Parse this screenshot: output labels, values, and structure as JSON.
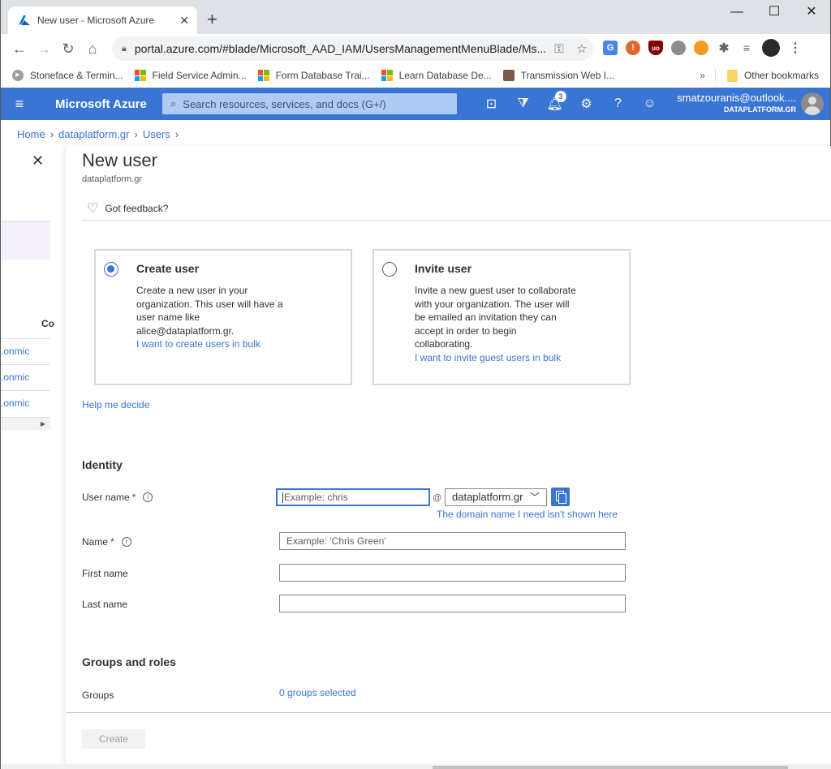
{
  "browser": {
    "tab_title": "New user - Microsoft Azure",
    "new_tab": "+",
    "window_controls": {
      "minimize": "—",
      "maximize": "☐",
      "close": "✕"
    },
    "url": "portal.azure.com/#blade/Microsoft_AAD_IAM/UsersManagementMenuBlade/Ms...",
    "bookmarks": [
      {
        "label": "Stoneface & Termin...",
        "icon": "play-icon"
      },
      {
        "label": "Field Service Admin...",
        "icon": "microsoft-icon"
      },
      {
        "label": "Form Database Trai...",
        "icon": "microsoft-icon"
      },
      {
        "label": "Learn Database De...",
        "icon": "microsoft-icon"
      },
      {
        "label": "Transmission Web I...",
        "icon": "transmission-icon"
      }
    ],
    "more_bookmarks": "»",
    "other_bookmarks": "Other bookmarks"
  },
  "azure": {
    "brand": "Microsoft Azure",
    "search_placeholder": "Search resources, services, and docs (G+/)",
    "notification_count": "3",
    "account_email": "smatzouranis@outlook....",
    "account_tenant": "DATAPLATFORM.GR"
  },
  "breadcrumb": [
    "Home",
    "dataplatform.gr",
    "Users"
  ],
  "left_blade": {
    "column_header": "Co",
    "rows": [
      ".onmic",
      ".onmic",
      ".onmic"
    ]
  },
  "blade": {
    "title": "New user",
    "subtitle": "dataplatform.gr",
    "feedback": "Got feedback?",
    "options": [
      {
        "title": "Create user",
        "selected": true,
        "description": "Create a new user in your organization. This user will have a user name like alice@dataplatform.gr.",
        "link": "I want to create users in bulk"
      },
      {
        "title": "Invite user",
        "selected": false,
        "description": "Invite a new guest user to collaborate with your organization. The user will be emailed an invitation they can accept in order to begin collaborating.",
        "link": "I want to invite guest users in bulk"
      }
    ],
    "help_link": "Help me decide",
    "identity": {
      "heading": "Identity",
      "user_name_label": "User name",
      "user_name_placeholder": "Example: chris",
      "at": "@",
      "domain_value": "dataplatform.gr",
      "domain_link": "The domain name I need isn't shown here",
      "name_label": "Name",
      "name_placeholder": "Example: 'Chris Green'",
      "first_name_label": "First name",
      "first_name_value": "",
      "last_name_label": "Last name",
      "last_name_value": ""
    },
    "groups": {
      "heading": "Groups and roles",
      "groups_label": "Groups",
      "groups_value": "0 groups selected"
    },
    "create_button": "Create",
    "required_mark": "*",
    "info_glyph": "i"
  }
}
